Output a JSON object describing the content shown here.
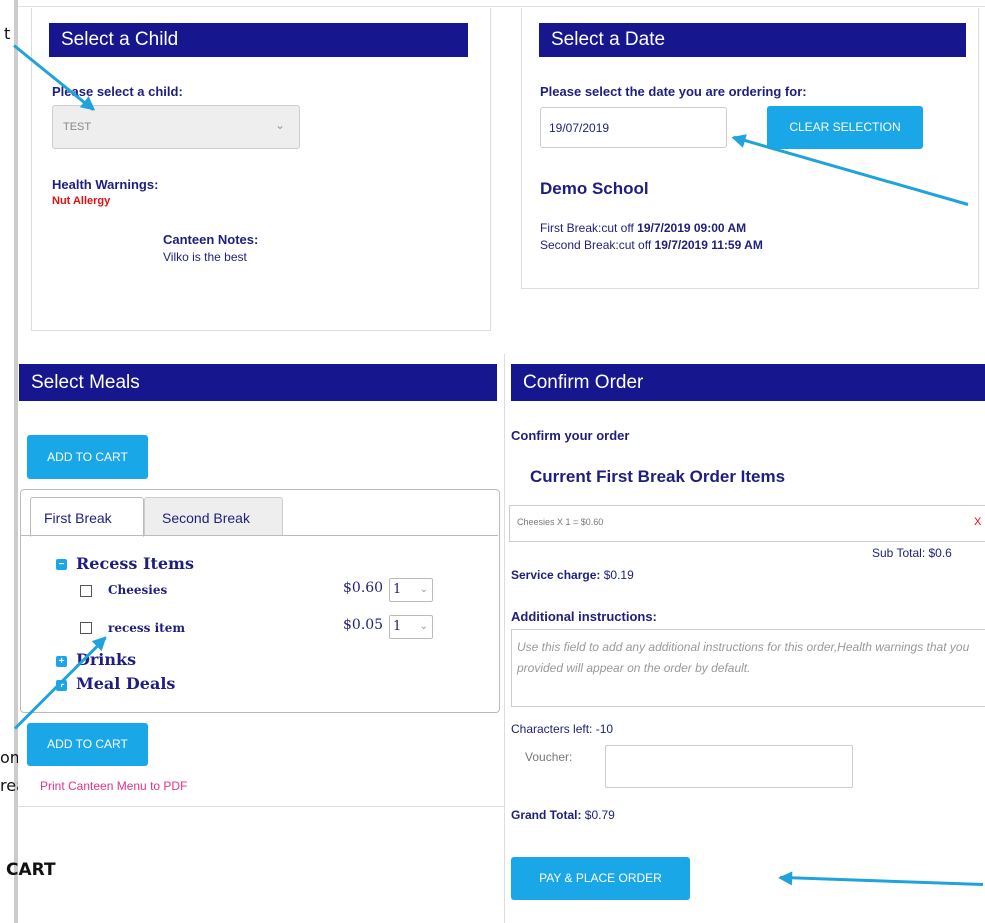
{
  "fragments": {
    "t": "t",
    "om": "om",
    "reak": "reak",
    "cart": "CART"
  },
  "child": {
    "header": "Select a Child",
    "prompt": "Please select a child:",
    "selected": "TEST",
    "health_label": "Health Warnings:",
    "health_value": "Nut Allergy",
    "notes_label": "Canteen Notes:",
    "notes_value": "Vilko is the best"
  },
  "date": {
    "header": "Select a Date",
    "prompt": "Please select the date you are ordering for:",
    "value": "19/07/2019",
    "clear_label": "CLEAR SELECTION",
    "school": "Demo School",
    "first_break_prefix": "First Break:cut off ",
    "first_break_time": "19/7/2019 09:00 AM",
    "second_break_prefix": "Second Break:cut off ",
    "second_break_time": "19/7/2019 11:59 AM"
  },
  "meals": {
    "header": "Select Meals",
    "add_to_cart": "ADD TO CART",
    "tabs": [
      "First Break",
      "Second Break"
    ],
    "categories": [
      "Recess Items",
      "Drinks",
      "Meal Deals"
    ],
    "items": [
      {
        "name": "Cheesies",
        "price": "$0.60",
        "qty": "1"
      },
      {
        "name": "recess item",
        "price": "$0.05",
        "qty": "1"
      }
    ],
    "pdf_link": "Print Canteen Menu to PDF"
  },
  "order": {
    "header": "Confirm Order",
    "confirm_label": "Confirm your order",
    "current_title": "Current First Break Order Items",
    "line_item": "Cheesies X 1 = $0.60",
    "remove": "X",
    "subtotal": "Sub Total: $0.6",
    "service_label": "Service charge:",
    "service_value": "$0.19",
    "instructions_label": "Additional instructions:",
    "instructions_placeholder": "Use this field to add any additional instructions for this order,Health warnings that you provided will appear on the order by default.",
    "chars_left": "Characters left: -10",
    "voucher_label": "Voucher:",
    "grand_label": "Grand Total:",
    "grand_value": "$0.79",
    "pay_label": "PAY & PLACE ORDER"
  },
  "colors": {
    "header": "#16168e",
    "accent": "#1aa7e8",
    "warning": "#e01010",
    "link": "#e2338c"
  }
}
